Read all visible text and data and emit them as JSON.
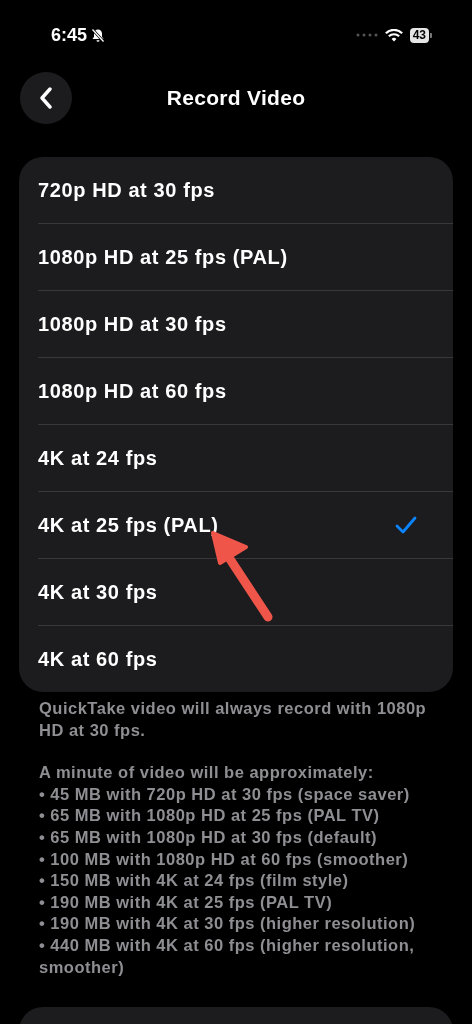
{
  "status_bar": {
    "time": "6:45",
    "battery": "43"
  },
  "nav": {
    "title": "Record Video"
  },
  "options": [
    {
      "label": "720p HD at 30 fps",
      "selected": false
    },
    {
      "label": "1080p HD at 25 fps (PAL)",
      "selected": false
    },
    {
      "label": "1080p HD at 30 fps",
      "selected": false
    },
    {
      "label": "1080p HD at 60 fps",
      "selected": false
    },
    {
      "label": "4K at 24 fps",
      "selected": false
    },
    {
      "label": "4K at 25 fps (PAL)",
      "selected": true
    },
    {
      "label": "4K at 30 fps",
      "selected": false
    },
    {
      "label": "4K at 60 fps",
      "selected": false
    }
  ],
  "annotation": {
    "kind": "arrow"
  },
  "footer": {
    "note": "QuickTake video will always record with 1080p HD at 30 fps.",
    "heading": "A minute of video will be approximately:",
    "items": [
      "• 45 MB with 720p HD at 30 fps (space saver)",
      "• 65 MB with 1080p HD at 25 fps (PAL TV)",
      "• 65 MB with 1080p HD at 30 fps (default)",
      "• 100 MB with 1080p HD at 60 fps (smoother)",
      "• 150 MB with 4K at 24 fps (film style)",
      "• 190 MB with 4K at 25 fps (PAL TV)",
      "• 190 MB with 4K at 30 fps (higher resolution)",
      "• 440 MB with 4K at 60 fps (higher resolution, smoother)"
    ]
  }
}
